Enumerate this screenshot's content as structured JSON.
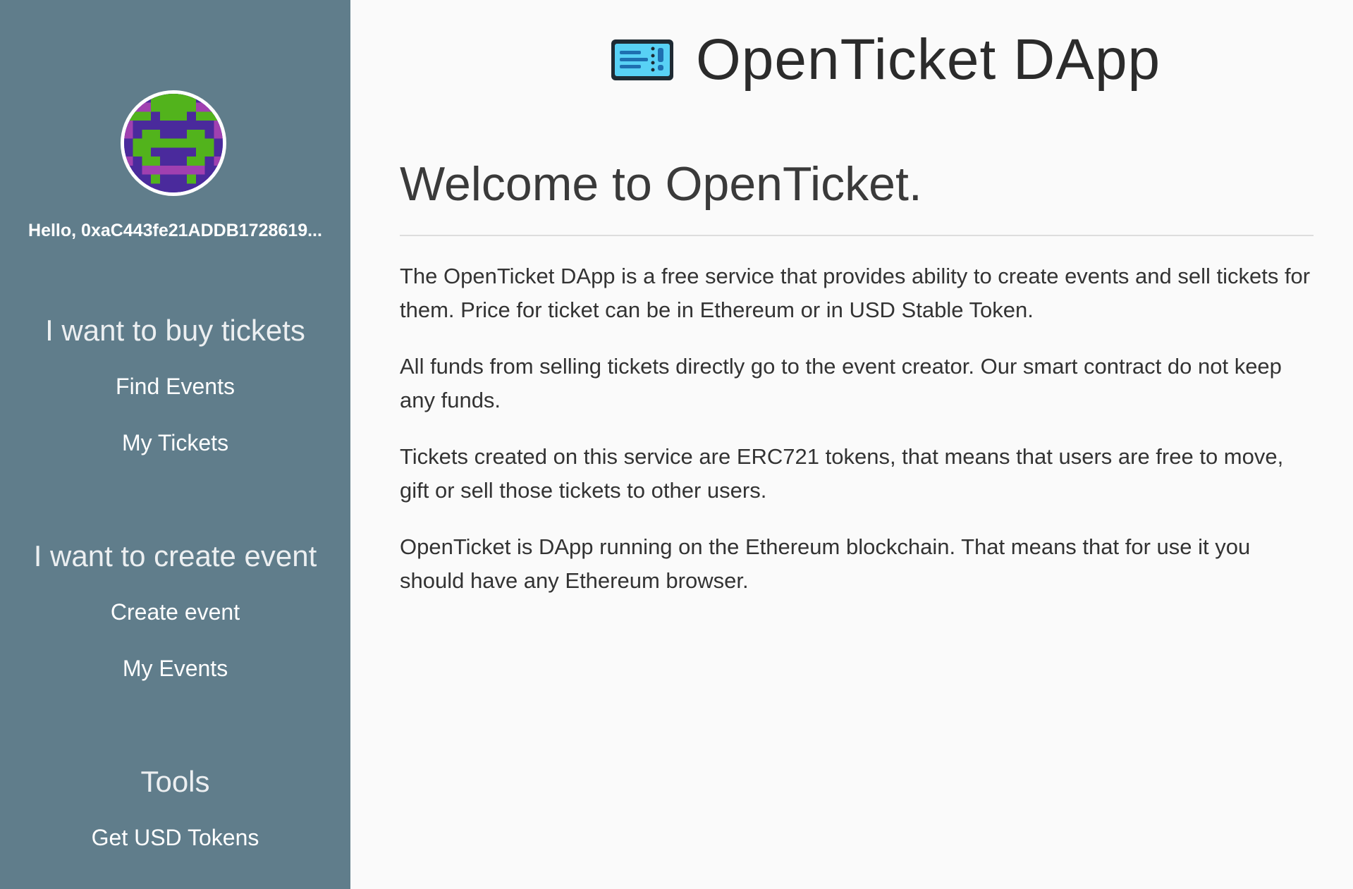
{
  "sidebar": {
    "greeting": "Hello, 0xaC443fe21ADDB1728619...",
    "sections": [
      {
        "title": "I want to buy tickets",
        "links": [
          "Find Events",
          "My Tickets"
        ]
      },
      {
        "title": "I want to create event",
        "links": [
          "Create event",
          "My Events"
        ]
      },
      {
        "title": "Tools",
        "links": [
          "Get USD Tokens"
        ]
      }
    ],
    "background_color": "#607d8b"
  },
  "header": {
    "brand": "OpenTicket DApp",
    "icon": "ticket-icon"
  },
  "main": {
    "heading": "Welcome to OpenTicket.",
    "paragraphs": [
      "The OpenTicket DApp is a free service that provides ability to create events and sell tickets for them. Price for ticket can be in Ethereum or in USD Stable Token.",
      "All funds from selling tickets directly go to the event creator. Our smart contract do not keep any funds.",
      "Tickets created on this service are ERC721 tokens, that means that users are free to move, gift or sell those tickets to other users.",
      "OpenTicket is DApp running on the Ethereum blockchain. That means that for use it you should have any Ethereum browser."
    ]
  }
}
